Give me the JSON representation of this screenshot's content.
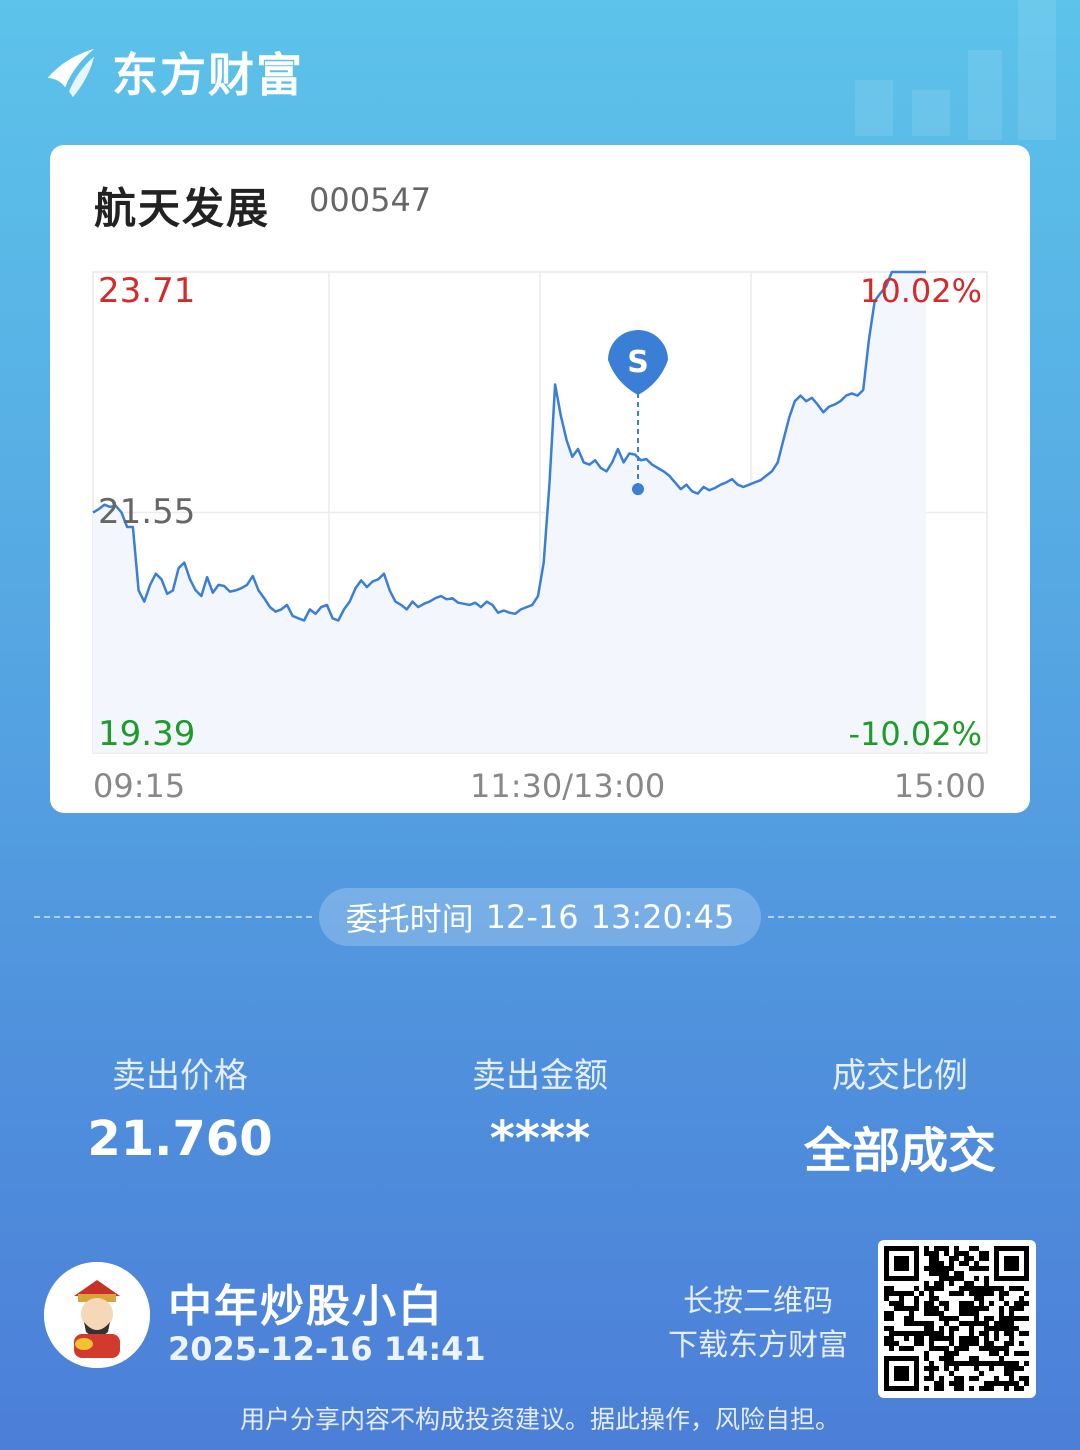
{
  "brand": {
    "name": "东方财富"
  },
  "stock": {
    "name": "航天发展",
    "code": "000547"
  },
  "chart_data": {
    "type": "line",
    "title": "",
    "price_high": "23.71",
    "price_mid": "21.55",
    "price_low": "19.39",
    "pct_high": "10.02%",
    "pct_low": "-10.02%",
    "time_labels": [
      "09:15",
      "11:30/13:00",
      "15:00"
    ],
    "ylim": [
      19.39,
      23.71
    ],
    "marker": {
      "label": "S",
      "price": 21.76,
      "time": "13:20"
    },
    "series": [
      {
        "values": [
          21.55,
          21.58,
          21.62,
          21.6,
          21.61,
          21.55,
          21.42,
          21.42,
          20.85,
          20.75,
          20.9,
          21.0,
          20.95,
          20.82,
          20.85,
          21.05,
          21.1,
          20.95,
          20.85,
          20.8,
          20.97,
          20.83,
          20.9,
          20.89,
          20.84,
          20.85,
          20.87,
          20.9,
          20.98,
          20.85,
          20.78,
          20.7,
          20.66,
          20.68,
          20.72,
          20.62,
          20.6,
          20.58,
          20.68,
          20.64,
          20.7,
          20.72,
          20.6,
          20.58,
          20.68,
          20.75,
          20.87,
          20.94,
          20.88,
          20.93,
          20.95,
          21.0,
          20.85,
          20.75,
          20.72,
          20.68,
          20.75,
          20.7,
          20.73,
          20.75,
          20.78,
          20.8,
          20.77,
          20.78,
          20.74,
          20.73,
          20.72,
          20.74,
          20.7,
          20.75,
          20.72,
          20.65,
          20.67,
          20.65,
          20.64,
          20.68,
          20.7,
          20.72,
          20.8,
          21.1,
          21.8,
          22.7,
          22.42,
          22.2,
          22.05,
          22.12,
          22.0,
          21.98,
          22.02,
          21.95,
          21.92,
          22.0,
          22.12,
          22.0,
          22.08,
          22.07,
          22.02,
          22.03,
          21.98,
          21.95,
          21.92,
          21.88,
          21.82,
          21.76,
          21.8,
          21.74,
          21.72,
          21.78,
          21.75,
          21.77,
          21.8,
          21.82,
          21.85,
          21.8,
          21.78,
          21.8,
          21.82,
          21.84,
          21.88,
          21.92,
          22.0,
          22.2,
          22.4,
          22.55,
          22.6,
          22.55,
          22.58,
          22.52,
          22.45,
          22.5,
          22.52,
          22.55,
          22.6,
          22.62,
          22.6,
          22.65,
          23.1,
          23.45,
          23.52,
          23.58,
          23.71,
          23.71,
          23.71,
          23.71,
          23.71,
          23.71,
          23.71
        ]
      }
    ]
  },
  "order": {
    "label": "委托时间",
    "date": "12-16",
    "time": "13:20:45"
  },
  "stats": [
    {
      "label": "卖出价格",
      "value": "21.760"
    },
    {
      "label": "卖出金额",
      "value": "****"
    },
    {
      "label": "成交比例",
      "value": "全部成交"
    }
  ],
  "user": {
    "name": "中年炒股小白",
    "datetime": "2025-12-16 14:41"
  },
  "qr_hint": {
    "line1": "长按二维码",
    "line2": "下载东方财富"
  },
  "disclaimer": "用户分享内容不构成投资建议。据此操作，风险自担。",
  "colors": {
    "line": "#3a7fd5",
    "up": "#d42a2a",
    "down": "#1e9c2a",
    "bg_top": "#5cc3ea",
    "bg_bottom": "#4c7fd8"
  }
}
